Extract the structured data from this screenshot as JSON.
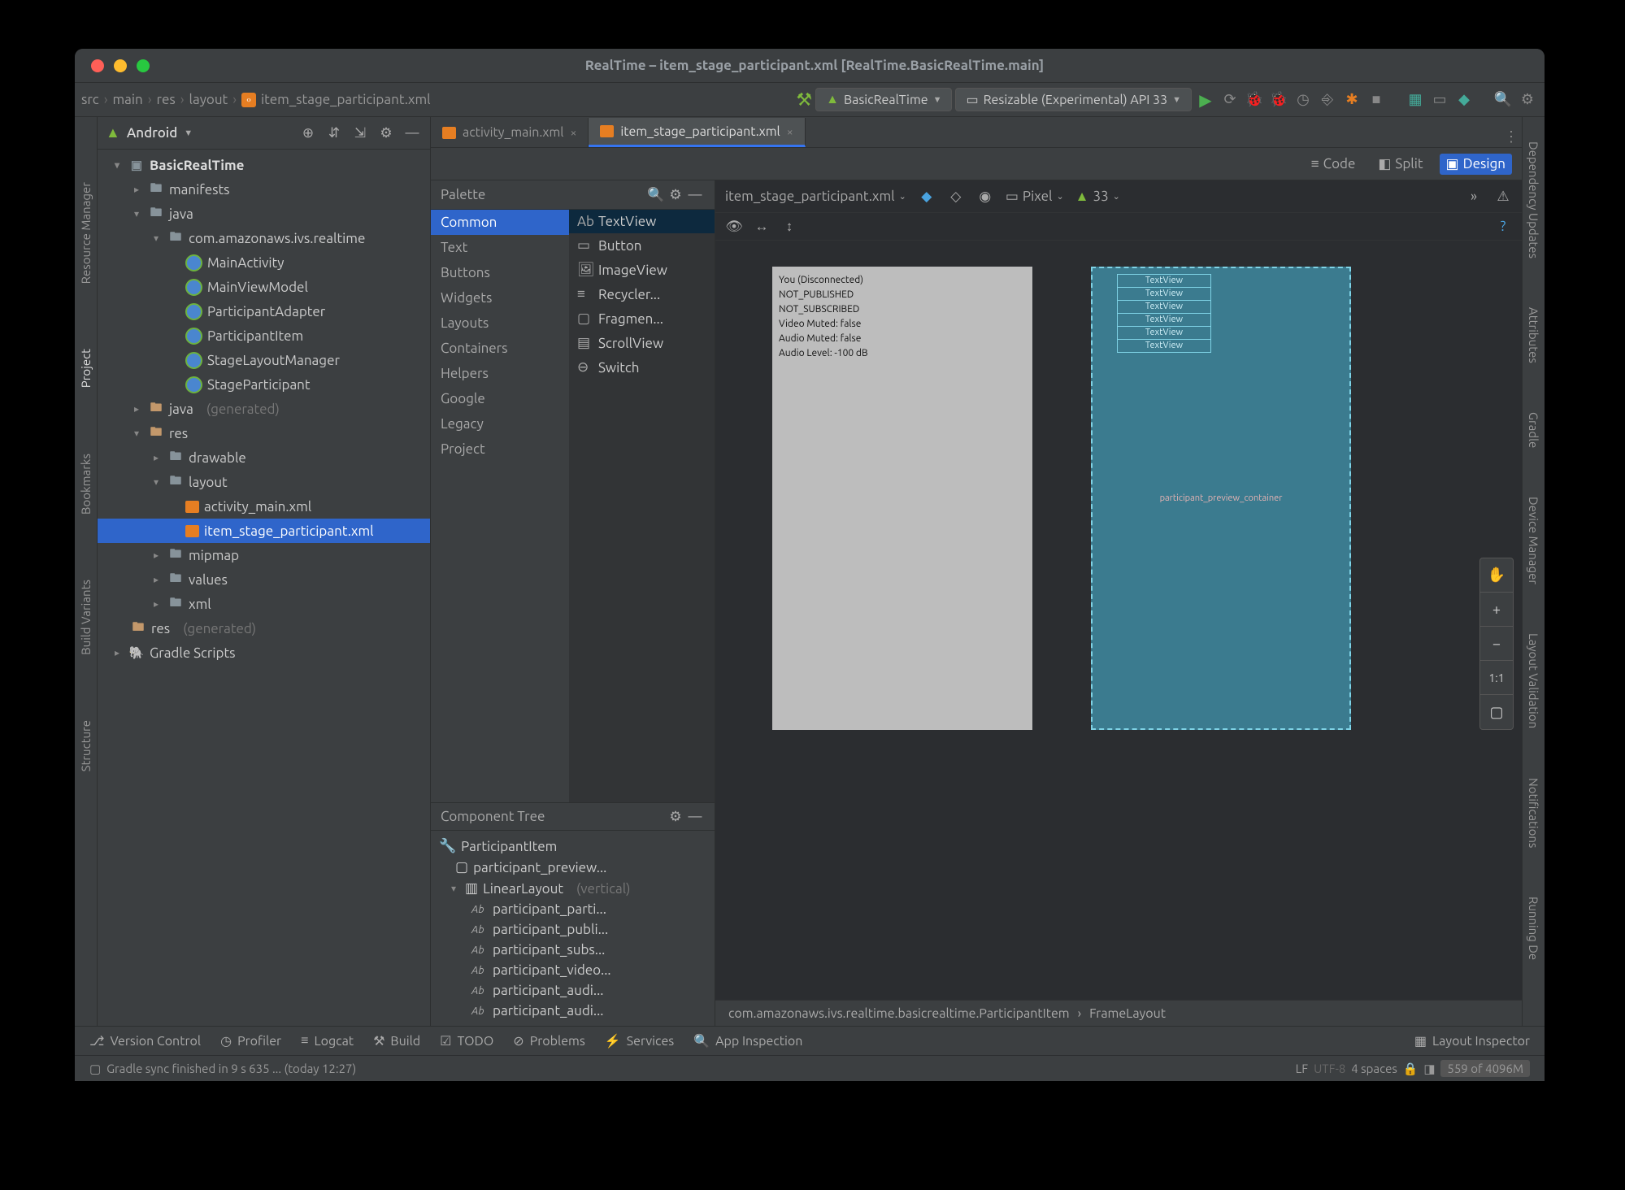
{
  "window": {
    "title": "RealTime – item_stage_participant.xml [RealTime.BasicRealTime.main]"
  },
  "breadcrumb": {
    "p1": "src",
    "p2": "main",
    "p3": "res",
    "p4": "layout",
    "p5": "item_stage_participant.xml"
  },
  "runconfig": {
    "config": "BasicRealTime",
    "device": "Resizable (Experimental) API 33"
  },
  "project": {
    "label": "Android",
    "root": "BasicRealTime",
    "manifests": "manifests",
    "java": "java",
    "pkg": "com.amazonaws.ivs.realtime",
    "classes": [
      "MainActivity",
      "MainViewModel",
      "ParticipantAdapter",
      "ParticipantItem",
      "StageLayoutManager",
      "StageParticipant"
    ],
    "javag": "java",
    "gen": "(generated)",
    "res": "res",
    "resdirs": [
      "drawable",
      "layout",
      "mipmap",
      "values",
      "xml"
    ],
    "layout_files": [
      "activity_main.xml",
      "item_stage_participant.xml"
    ],
    "resg": "res",
    "gradle": "Gradle Scripts"
  },
  "tabs": {
    "t1": "activity_main.xml",
    "t2": "item_stage_participant.xml"
  },
  "viewmodes": {
    "code": "Code",
    "split": "Split",
    "design": "Design"
  },
  "palette": {
    "title": "Palette",
    "cats": [
      "Common",
      "Text",
      "Buttons",
      "Widgets",
      "Layouts",
      "Containers",
      "Helpers",
      "Google",
      "Legacy",
      "Project"
    ],
    "items": [
      "TextView",
      "Button",
      "ImageView",
      "Recycler...",
      "Fragmen...",
      "ScrollView",
      "Switch"
    ]
  },
  "comptree": {
    "title": "Component Tree",
    "root": "ParticipantItem",
    "child1": "participant_preview...",
    "ll": "LinearLayout",
    "llmod": "(vertical)",
    "leaves": [
      "participant_parti...",
      "participant_publi...",
      "participant_subs...",
      "participant_video...",
      "participant_audi...",
      "participant_audi..."
    ]
  },
  "canvas": {
    "file": "item_stage_participant.xml",
    "device": "Pixel",
    "api": "33",
    "overlay": [
      "You (Disconnected)",
      "NOT_PUBLISHED",
      "NOT_SUBSCRIBED",
      "Video Muted: false",
      "Audio Muted: false",
      "Audio Level: -100 dB"
    ],
    "bp": [
      "TextView",
      "TextView",
      "TextView",
      "TextView",
      "TextView",
      "TextView"
    ],
    "bplabel": "participant_preview_container",
    "bc1": "com.amazonaws.ivs.realtime.basicrealtime.ParticipantItem",
    "bc2": "FrameLayout",
    "one": "1:1"
  },
  "rails": {
    "left": [
      "Resource Manager",
      "Project",
      "Bookmarks",
      "Build Variants",
      "Structure"
    ],
    "right": [
      "Dependency Updates",
      "Attributes",
      "Gradle",
      "Device Manager",
      "Layout Validation",
      "Notifications",
      "Running De"
    ]
  },
  "bottom": {
    "items": [
      "Version Control",
      "Profiler",
      "Logcat",
      "Build",
      "TODO",
      "Problems",
      "Services",
      "App Inspection"
    ],
    "right": "Layout Inspector"
  },
  "status": {
    "msg": "Gradle sync finished in 9 s 635 ... (today 12:27)",
    "le": "LF",
    "enc": "UTF-8",
    "indent": "4 spaces",
    "mem": "559 of 4096M"
  }
}
